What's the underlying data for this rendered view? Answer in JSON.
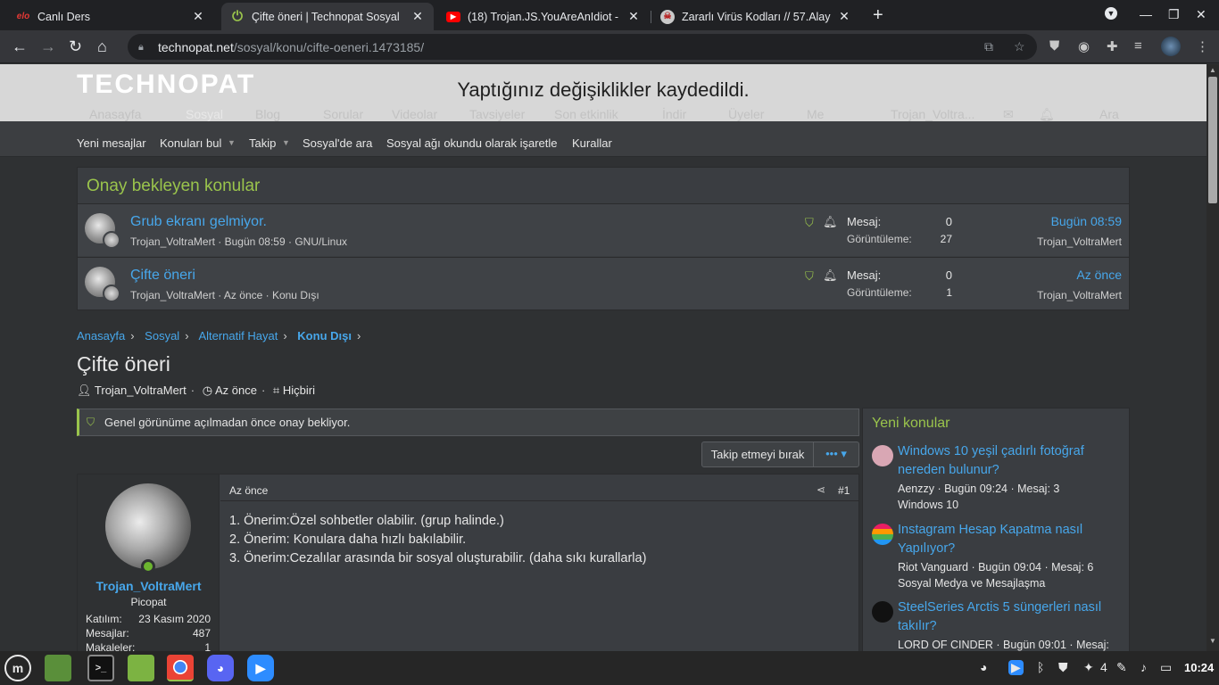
{
  "browser": {
    "tabs": [
      {
        "icon": "elo-icon",
        "label": "Canlı Ders",
        "fav": "elo"
      },
      {
        "icon": "technopat-icon",
        "label": "Çifte öneri | Technopat Sosyal",
        "fav": "⏻"
      },
      {
        "icon": "youtube-icon",
        "label": "(18) Trojan.JS.YouAreAnIdiot -",
        "fav": "▶"
      },
      {
        "icon": "skull-icon",
        "label": "Zararlı Virüs Kodları // 57.Alay",
        "fav": "☠"
      }
    ],
    "url_host": "technopat.net",
    "url_path": "/sosyal/konu/cifte-oeneri.1473185/"
  },
  "site": {
    "logo": "TECHNOPAT",
    "flash": "Yaptığınız değişiklikler kaydedildi.",
    "nav": [
      "Anasayfa",
      "Sosyal",
      "Blog",
      "Sorular",
      "Videolar",
      "Tavsiyeler",
      "Son etkinlik",
      "İndir",
      "Üyeler",
      "Me"
    ],
    "nav_user": "Trojan_Voltra...",
    "nav_search": "Ara",
    "subnav": [
      "Yeni mesajlar",
      "Konuları bul",
      "Takip",
      "Sosyal'de ara",
      "Sosyal ağı okundu olarak işaretle",
      "Kurallar"
    ]
  },
  "approval": {
    "heading": "Onay bekleyen konular",
    "stat_msg": "Mesaj:",
    "stat_views": "Görüntüleme:",
    "rows": [
      {
        "title": "Grub ekranı gelmiyor.",
        "meta": "Trojan_VoltraMert · Bugün 08:59 · GNU/Linux",
        "replies": "0",
        "views": "27",
        "last_time": "Bugün 08:59",
        "last_user": "Trojan_VoltraMert"
      },
      {
        "title": "Çifte öneri",
        "meta": "Trojan_VoltraMert · Az önce · Konu Dışı",
        "replies": "0",
        "views": "1",
        "last_time": "Az önce",
        "last_user": "Trojan_VoltraMert"
      }
    ]
  },
  "breadcrumb": [
    "Anasayfa",
    "Sosyal",
    "Alternatif Hayat",
    "Konu Dışı"
  ],
  "thread": {
    "title": "Çifte öneri",
    "author": "Trojan_VoltraMert",
    "time": "Az önce",
    "tags": "Hiçbiri",
    "notice": "Genel görünüme açılmadan önce onay bekliyor.",
    "unwatch": "Takip etmeyi bırak",
    "more": "••• ▾"
  },
  "post": {
    "username": "Trojan_VoltraMert",
    "usertitle": "Picopat",
    "stats": [
      {
        "k": "Katılım:",
        "v": "23 Kasım 2020"
      },
      {
        "k": "Mesajlar:",
        "v": "487"
      },
      {
        "k": "Makaleler:",
        "v": "1"
      }
    ],
    "time": "Az önce",
    "number": "#1",
    "lines": [
      "1. Önerim:Özel sohbetler olabilir. (grup halinde.)",
      "2. Önerim: Konulara daha hızlı bakılabilir.",
      "3. Önerim:Cezalılar arasında bir sosyal oluşturabilir. (daha sıkı kurallarla)"
    ]
  },
  "sidebar": {
    "heading": "Yeni konular",
    "items": [
      {
        "title": "Windows 10 yeşil çadırlı fotoğraf nereden bulunur?",
        "meta": "Aenzzy · Bugün 09:24 · Mesaj: 3",
        "forum": "Windows 10",
        "avatar_color": "#d9a7b4"
      },
      {
        "title": "Instagram Hesap Kapatma nasıl Yapılıyor?",
        "meta": "Riot Vanguard · Bugün 09:04 · Mesaj: 6",
        "forum": "Sosyal Medya ve Mesajlaşma",
        "avatar_color": "#3b4fb8"
      },
      {
        "title": "SteelSeries Arctis 5 süngerleri nasıl takılır?",
        "meta": "LORD OF CINDER · Bugün 09:01 · Mesaj:",
        "forum": "",
        "avatar_color": "#111111"
      }
    ]
  },
  "taskbar": {
    "tray_badge": "4",
    "clock": "10:24"
  }
}
